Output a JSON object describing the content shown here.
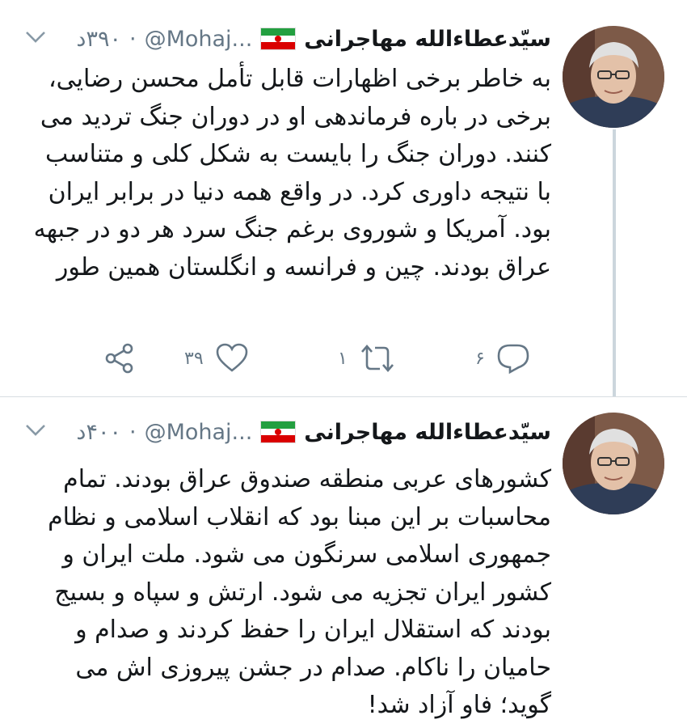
{
  "tweets": [
    {
      "author_name": "سیّدعطاءالله مهاجرانی",
      "handle": "@Mohaj...",
      "separator": "·",
      "time": "۳۹۰د",
      "text": "به خاطر برخی اظهارات قابل تأمل محسن رضایی، برخی در باره فرماندهی او در دوران جنگ تردید می کنند. دوران جنگ را بایست به شکل کلی و متناسب با نتیجه داوری کرد. در واقع همه دنیا در برابر ایران بود. آمریکا و شوروی برغم جنگ سرد هر دو در جبهه عراق بودند. چین و فرانسه و انگلستان همین طور",
      "reply_count": "۶",
      "retweet_count": "۱",
      "like_count": "۳۹",
      "icons": {
        "flag": "iran-flag-icon",
        "menu": "chevron-down-icon",
        "reply": "reply-icon",
        "retweet": "retweet-icon",
        "like": "heart-icon",
        "share": "share-icon"
      }
    },
    {
      "author_name": "سیّدعطاءالله مهاجرانی",
      "handle": "@Mohaj...",
      "separator": "·",
      "time": "۴۰۰د",
      "text": "کشورهای عربی منطقه صندوق عراق بودند. تمام محاسبات بر این مبنا بود که انقلاب اسلامی و نظام جمهوری اسلامی سرنگون می شود. ملت ایران و کشور ایران تجزیه می شود. ارتش و سپاه و بسیج بودند که استقلال ایران را حفظ کردند و صدام و حامیان را ناکام. صدام در جشن پیروزی اش می گوید؛ فاو آزاد شد!",
      "icons": {
        "flag": "iran-flag-icon",
        "menu": "chevron-down-icon"
      }
    }
  ],
  "colors": {
    "text": "#14171a",
    "muted": "#657786",
    "thread_line": "#ccd6dd"
  }
}
